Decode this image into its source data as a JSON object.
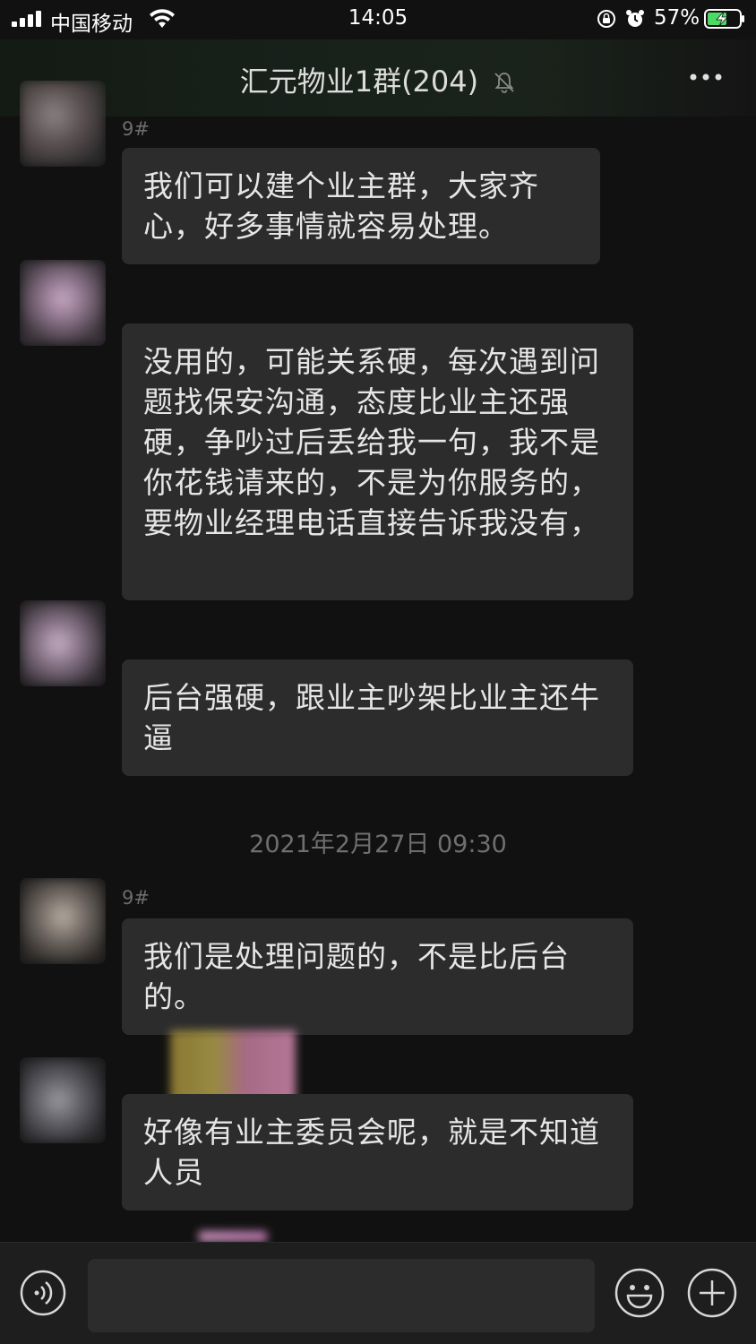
{
  "status_bar": {
    "carrier": "中国移动",
    "time": "14:05",
    "battery": "57%"
  },
  "nav": {
    "title": "汇元物业1群(204)"
  },
  "timestamp": "2021年2月27日 09:30",
  "messages": [
    {
      "sender": "9#",
      "text": "我们可以建个业主群，大家齐心，好多事情就容易处理。"
    },
    {
      "sender": "",
      "text": "没用的，可能关系硬，每次遇到问题找保安沟通，态度比业主还强硬，争吵过后丢给我一句，我不是你花钱请来的，不是为你服务的，要物业经理电话直接告诉我没有，"
    },
    {
      "sender": "",
      "text": "后台强硬，跟业主吵架比业主还牛逼"
    },
    {
      "sender": "9#",
      "text": "我们是处理问题的，不是比后台的。"
    },
    {
      "sender": "",
      "text": "好像有业主委员会呢，就是不知道人员"
    }
  ],
  "input": {
    "value": "",
    "placeholder": ""
  },
  "colors": {
    "background": "#111111",
    "bubble": "#2c2c2c",
    "nav_tint": "#1a231b",
    "battery_green": "#4cd964"
  },
  "icons": [
    "signal-icon",
    "wifi-icon",
    "lock-rotation-icon",
    "alarm-icon",
    "battery-icon",
    "mute-bell-icon",
    "more-icon",
    "voice-icon",
    "emoji-icon",
    "plus-icon"
  ]
}
